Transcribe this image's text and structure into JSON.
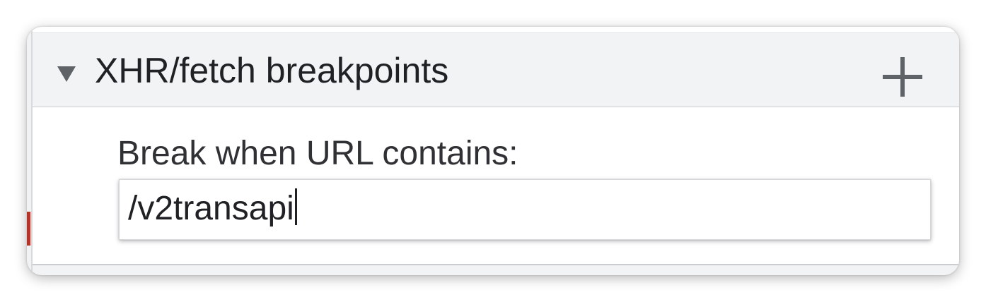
{
  "panel": {
    "title": "XHR/fetch breakpoints",
    "add_button_icon": "plus-icon",
    "expand_icon": "triangle-down-icon"
  },
  "editor": {
    "prompt_label": "Break when URL contains:",
    "input_value": "/v2transapi"
  },
  "colors": {
    "header_bg": "#f1f3f4",
    "text": "#202124",
    "icon": "#5f6368",
    "accent_red": "#b3352c"
  }
}
